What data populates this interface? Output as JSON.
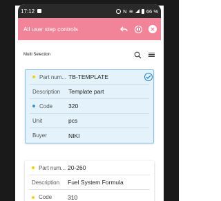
{
  "status_bar": {
    "time": "17:12",
    "battery": "66 %"
  },
  "app_bar": {
    "title": "All user step controls",
    "accent": "#f2849a"
  },
  "toolbar": {
    "label": "Multi Selection"
  },
  "cards": [
    {
      "selected": true,
      "rows": [
        {
          "key": "Part num...",
          "value": "TB-TEMPLATE",
          "dot": "#f2d300"
        },
        {
          "key": "Description",
          "value": "Template part"
        },
        {
          "key": "Code",
          "value": "320",
          "dot": "#3d8dd6"
        },
        {
          "key": "Unit",
          "value": "pcs"
        },
        {
          "key": "Buyer",
          "value": "NIKI"
        }
      ]
    },
    {
      "selected": false,
      "rows": [
        {
          "key": "Part num...",
          "value": "20-260",
          "dot": "#f2d300"
        },
        {
          "key": "Description",
          "value": "Fuel System Formula"
        },
        {
          "key": "Code",
          "value": "310",
          "dot": "#f2d300"
        }
      ]
    }
  ]
}
